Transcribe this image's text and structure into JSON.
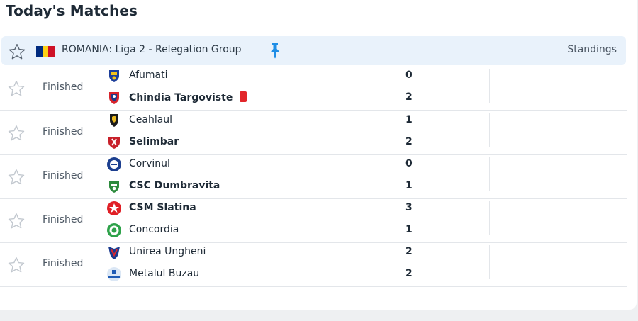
{
  "page": {
    "title": "Today's Matches"
  },
  "league": {
    "name": "ROMANIA: Liga 2 - Relegation Group",
    "flag_colors": [
      "#002b7f",
      "#fcd116",
      "#ce1126"
    ],
    "standings_label": "Standings",
    "star_icon": "star-outline-icon",
    "pin_icon": "pin-icon",
    "pin_color": "#1f8ee6"
  },
  "matches": [
    {
      "status": "Finished",
      "home": {
        "name": "Afumati",
        "score": "0",
        "winner": false
      },
      "away": {
        "name": "Chindia Targoviste",
        "score": "2",
        "winner": true,
        "red_card": true
      }
    },
    {
      "status": "Finished",
      "home": {
        "name": "Ceahlaul",
        "score": "1",
        "winner": false
      },
      "away": {
        "name": "Selimbar",
        "score": "2",
        "winner": true
      }
    },
    {
      "status": "Finished",
      "home": {
        "name": "Corvinul",
        "score": "0",
        "winner": false
      },
      "away": {
        "name": "CSC Dumbravita",
        "score": "1",
        "winner": true
      }
    },
    {
      "status": "Finished",
      "home": {
        "name": "CSM Slatina",
        "score": "3",
        "winner": true
      },
      "away": {
        "name": "Concordia",
        "score": "1",
        "winner": false
      }
    },
    {
      "status": "Finished",
      "home": {
        "name": "Unirea Ungheni",
        "score": "2",
        "winner": false
      },
      "away": {
        "name": "Metalul Buzau",
        "score": "2",
        "winner": false
      }
    }
  ],
  "colors": {
    "accent": "#1f8ee6",
    "red_card": "#e2262a",
    "league_bg": "#e9f2fb"
  }
}
